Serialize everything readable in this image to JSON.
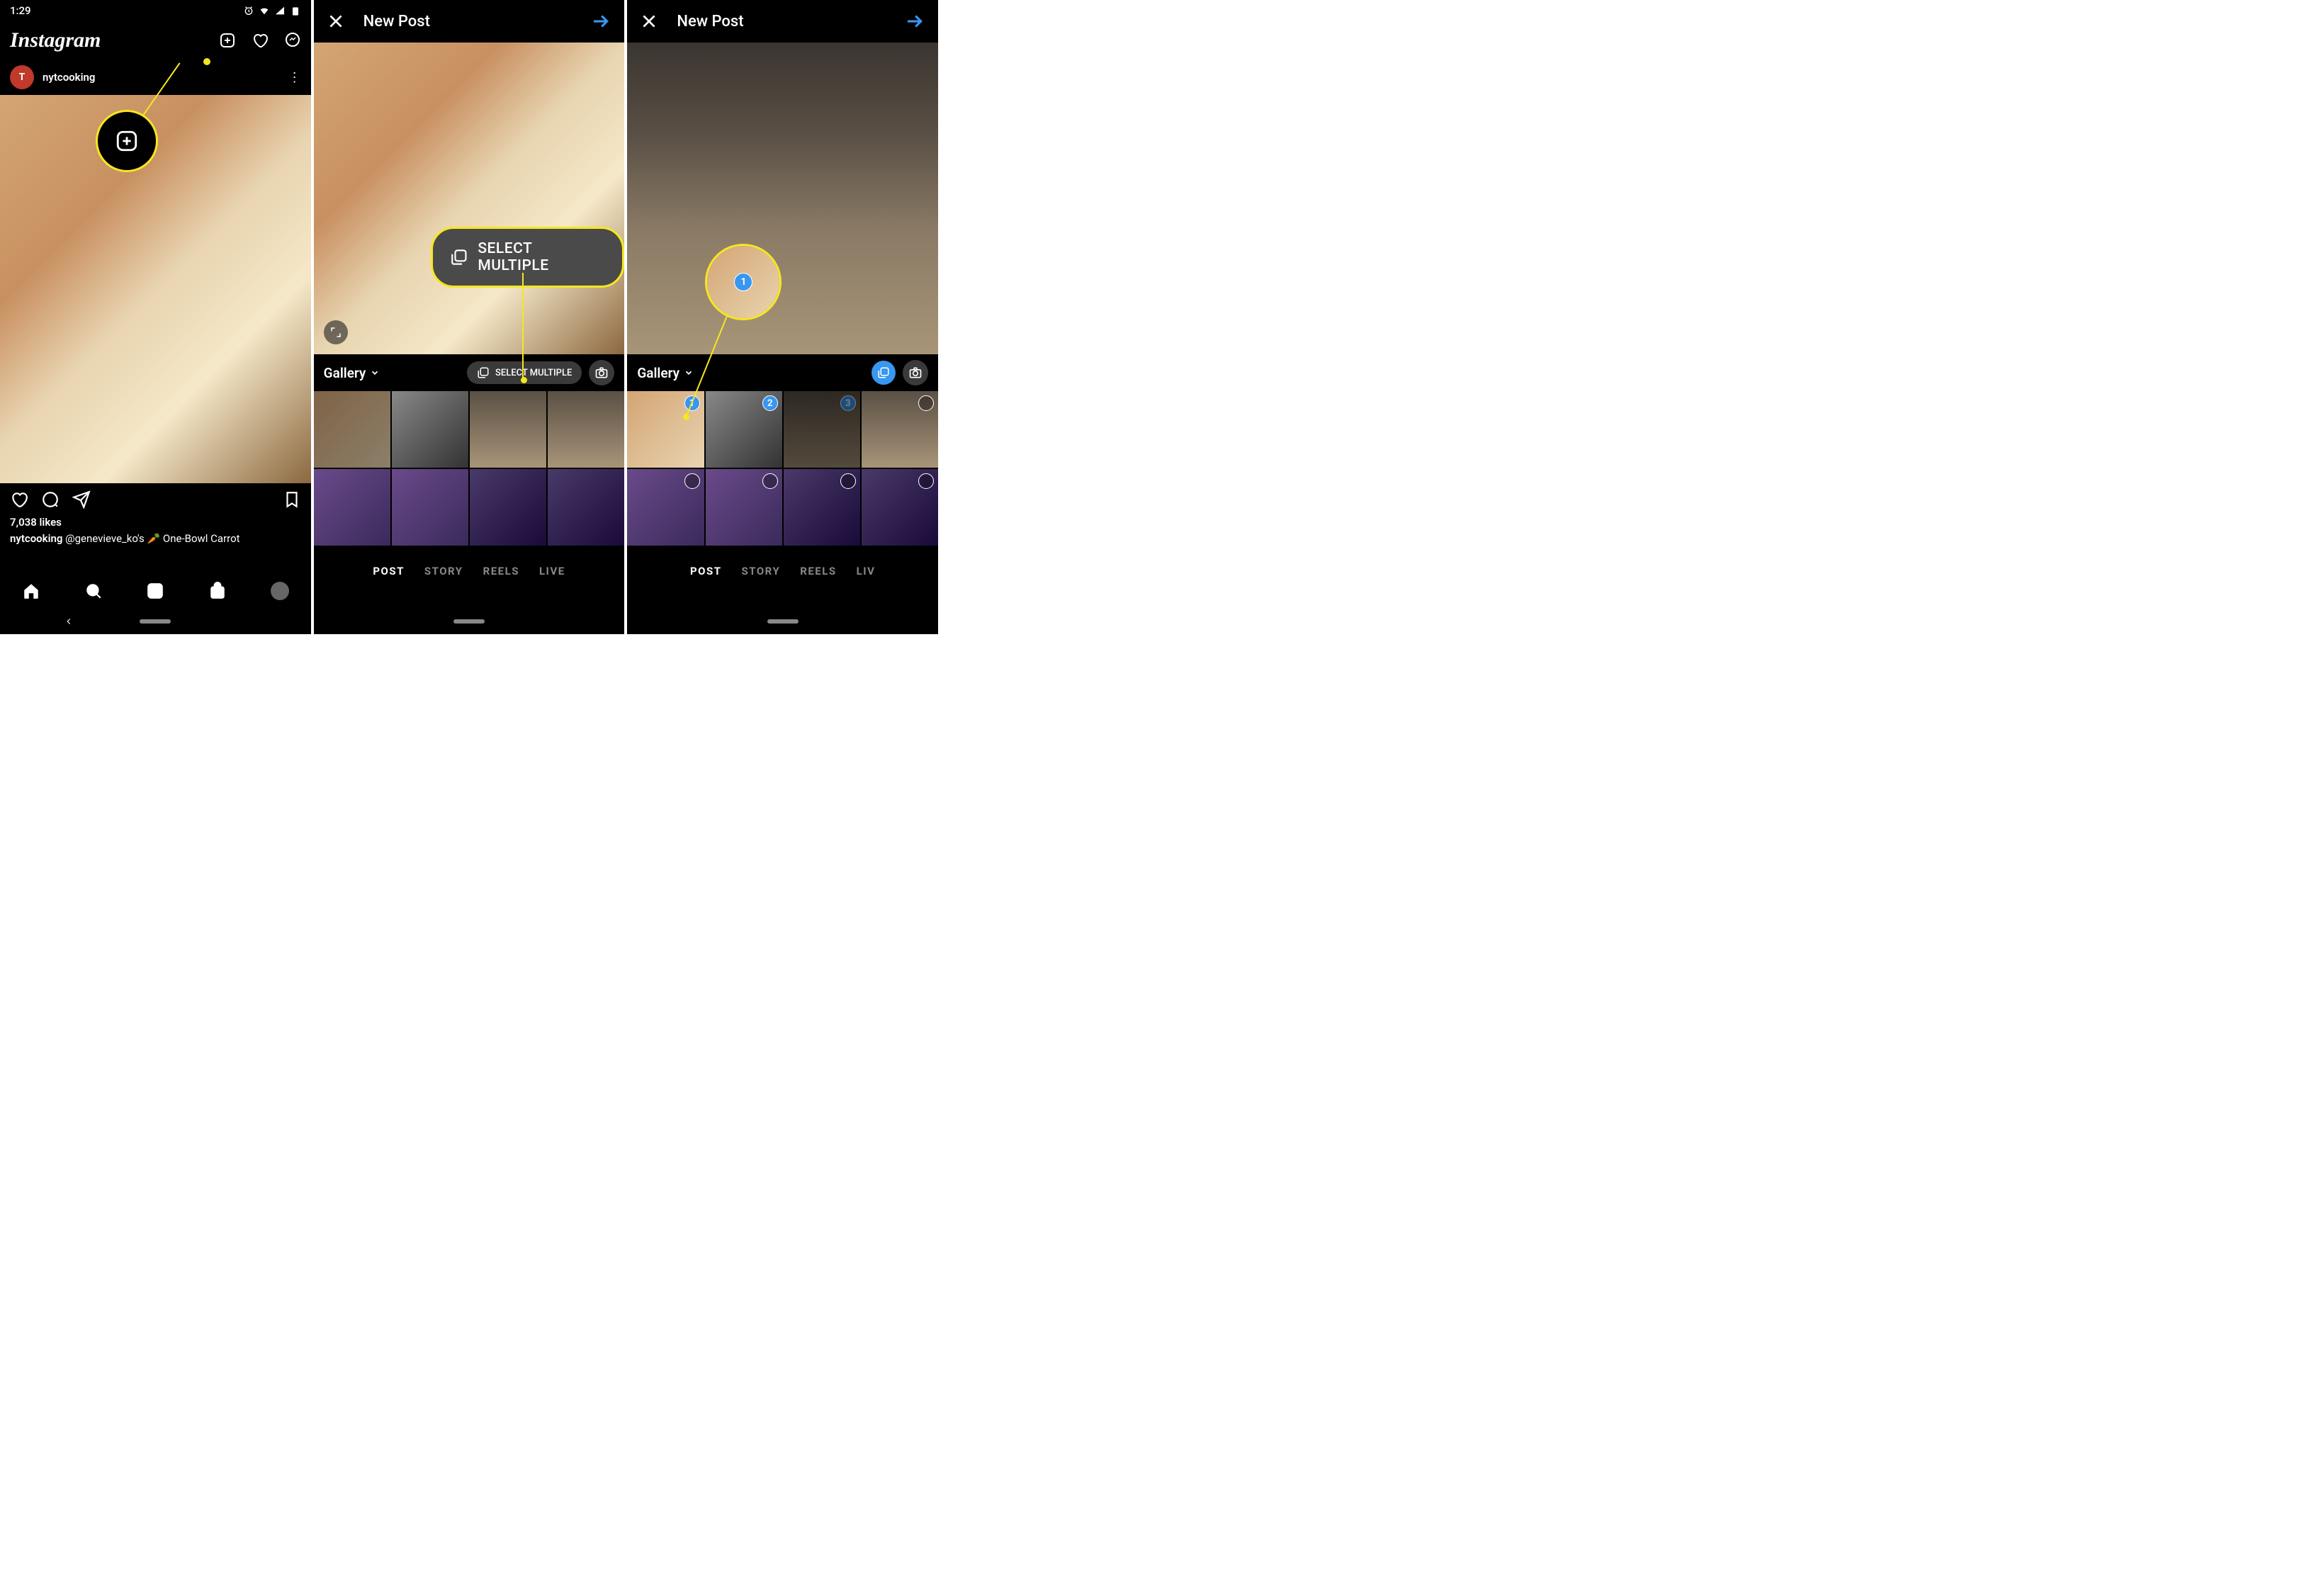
{
  "status": {
    "time": "1:29"
  },
  "screen1": {
    "logo": "Instagram",
    "post": {
      "username": "nytcooking",
      "avatar_letter": "T",
      "likes": "7,038 likes",
      "caption_user": "nytcooking",
      "caption_mention": "@genevieve_ko's",
      "caption_emoji": "🥕",
      "caption_rest": "One-Bowl Carrot"
    }
  },
  "new_post": {
    "title": "New Post",
    "gallery_label": "Gallery",
    "select_multiple": "SELECT MULTIPLE",
    "tabs": [
      "POST",
      "STORY",
      "REELS",
      "LIVE"
    ],
    "tabs3": [
      "POST",
      "STORY",
      "REELS",
      "LIV"
    ]
  },
  "callouts": {
    "select_multiple_big": "SELECT MULTIPLE",
    "badge_1": "1"
  },
  "selection": {
    "b1": "1",
    "b2": "2",
    "b3": "3"
  }
}
